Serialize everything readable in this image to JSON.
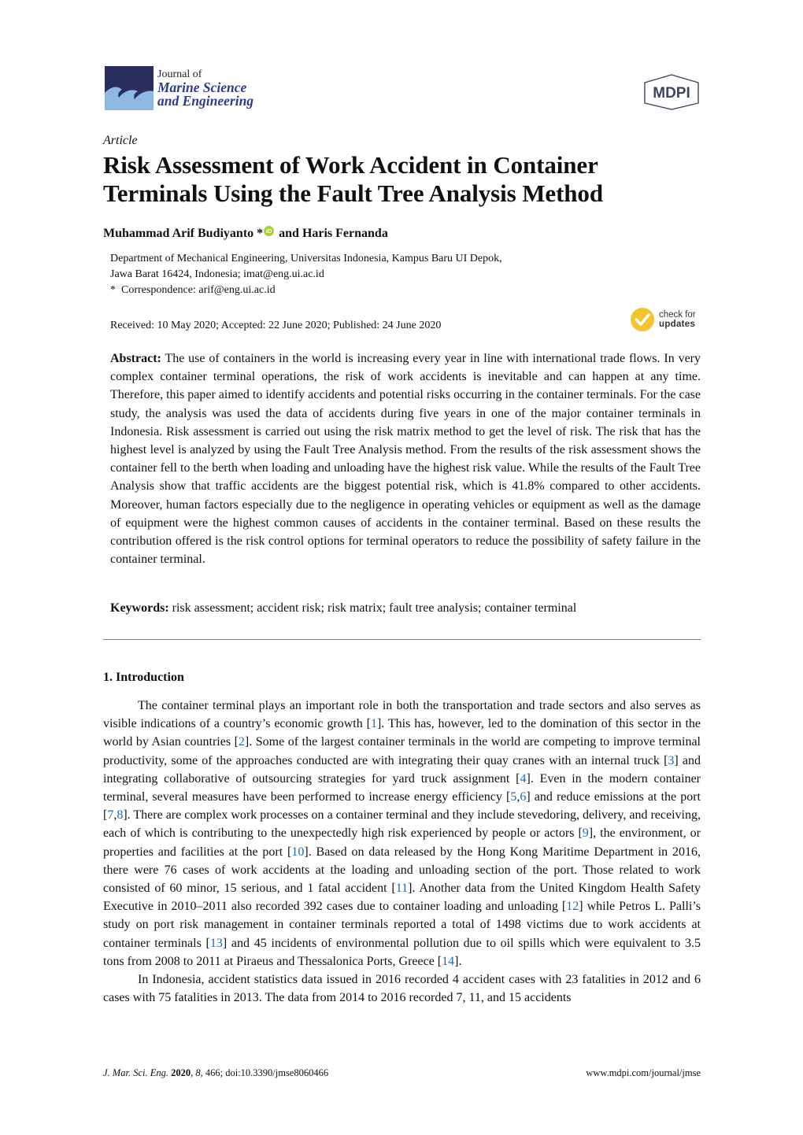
{
  "header": {
    "journal": {
      "line1": "Journal of",
      "line2": "Marine Science",
      "line3": "and Engineering"
    },
    "publisher_logo": "MDPI",
    "colors": {
      "journal_navy": "#2a2e5c",
      "journal_wave": "#8fb9e3",
      "journal_text": "#2e3b8c",
      "orcid_green": "#a6ce39",
      "update_yellow": "#f5c32c",
      "citation_blue": "#1f6ab0"
    }
  },
  "article": {
    "type": "Article",
    "title": "Risk Assessment of Work Accident in Container Terminals Using the Fault Tree Analysis Method",
    "authors": {
      "first": "Muhammad Arif Budiyanto",
      "first_mark": "*",
      "orcid_icon": "iD",
      "joiner": "and",
      "second": "Haris Fernanda"
    },
    "affiliation_line1": "Department of Mechanical Engineering, Universitas Indonesia, Kampus Baru UI Depok,",
    "affiliation_line2": "Jawa Barat 16424, Indonesia; imat@eng.ui.ac.id",
    "correspondence_mark": "*",
    "correspondence": "Correspondence: arif@eng.ui.ac.id",
    "dates": "Received: 10 May 2020; Accepted: 22 June 2020; Published: 24 June 2020",
    "check_updates": {
      "line1": "check for",
      "line2": "updates"
    }
  },
  "abstract": {
    "label": "Abstract:",
    "text": "The use of containers in the world is increasing every year in line with international trade flows. In very complex container terminal operations, the risk of work accidents is inevitable and can happen at any time. Therefore, this paper aimed to identify accidents and potential risks occurring in the container terminals. For the case study, the analysis was used the data of accidents during five years in one of the major container terminals in Indonesia. Risk assessment is carried out using the risk matrix method to get the level of risk. The risk that has the highest level is analyzed by using the Fault Tree Analysis method. From the results of the risk assessment shows the container fell to the berth when loading and unloading have the highest risk value. While the results of the Fault Tree Analysis show that traffic accidents are the biggest potential risk, which is 41.8% compared to other accidents. Moreover, human factors especially due to the negligence in operating vehicles or equipment as well as the damage of equipment were the highest common causes of accidents in the container terminal. Based on these results the contribution offered is the risk control options for terminal operators to reduce the possibility of safety failure in the container terminal."
  },
  "keywords": {
    "label": "Keywords:",
    "text": "risk assessment; accident risk; risk matrix; fault tree analysis; container terminal"
  },
  "introduction": {
    "heading": "1. Introduction",
    "paragraphs": [
      [
        {
          "t": "The container terminal plays an important role in both the transportation and trade sectors and also serves as visible indications of a country’s economic growth ["
        },
        {
          "c": "1"
        },
        {
          "t": "]. This has, however, led to the domination of this sector in the world by Asian countries ["
        },
        {
          "c": "2"
        },
        {
          "t": "]. Some of the largest container terminals in the world are competing to improve terminal productivity, some of the approaches conducted are with integrating their quay cranes with an internal truck ["
        },
        {
          "c": "3"
        },
        {
          "t": "] and integrating collaborative of outsourcing strategies for yard truck assignment ["
        },
        {
          "c": "4"
        },
        {
          "t": "]. Even in the modern container terminal, several measures have been performed to increase energy efficiency ["
        },
        {
          "c": "5"
        },
        {
          "t": ","
        },
        {
          "c": "6"
        },
        {
          "t": "] and reduce emissions at the port ["
        },
        {
          "c": "7"
        },
        {
          "t": ","
        },
        {
          "c": "8"
        },
        {
          "t": "]. There are complex work processes on a container terminal and they include stevedoring, delivery, and receiving, each of which is contributing to the unexpectedly high risk experienced by people or actors ["
        },
        {
          "c": "9"
        },
        {
          "t": "], the environment, or properties and facilities at the port ["
        },
        {
          "c": "10"
        },
        {
          "t": "]. Based on data released by the Hong Kong Maritime Department in 2016, there were 76 cases of work accidents at the loading and unloading section of the port. Those related to work consisted of 60 minor, 15 serious, and 1 fatal accident ["
        },
        {
          "c": "11"
        },
        {
          "t": "]. Another data from the United Kingdom Health Safety Executive in 2010–2011 also recorded 392 cases due to container loading and unloading ["
        },
        {
          "c": "12"
        },
        {
          "t": "] while Petros L. Palli’s study on port risk management in container terminals reported a total of 1498 victims due to work accidents at container terminals ["
        },
        {
          "c": "13"
        },
        {
          "t": "] and 45 incidents of environmental pollution due to oil spills which were equivalent to 3.5 tons from 2008 to 2011 at Piraeus and Thessalonica Ports, Greece ["
        },
        {
          "c": "14"
        },
        {
          "t": "]."
        }
      ],
      [
        {
          "t": "In Indonesia, accident statistics data issued in 2016 recorded 4 accident cases with 23 fatalities in 2012 and 6 cases with 75 fatalities in 2013. The data from 2014 to 2016 recorded 7, 11, and 15 accidents"
        }
      ]
    ]
  },
  "footer": {
    "journal_abbrev": "J. Mar. Sci. Eng.",
    "year": "2020",
    "volume": "8",
    "rest": ", 466; doi:10.3390/jmse8060466",
    "url": "www.mdpi.com/journal/jmse"
  }
}
